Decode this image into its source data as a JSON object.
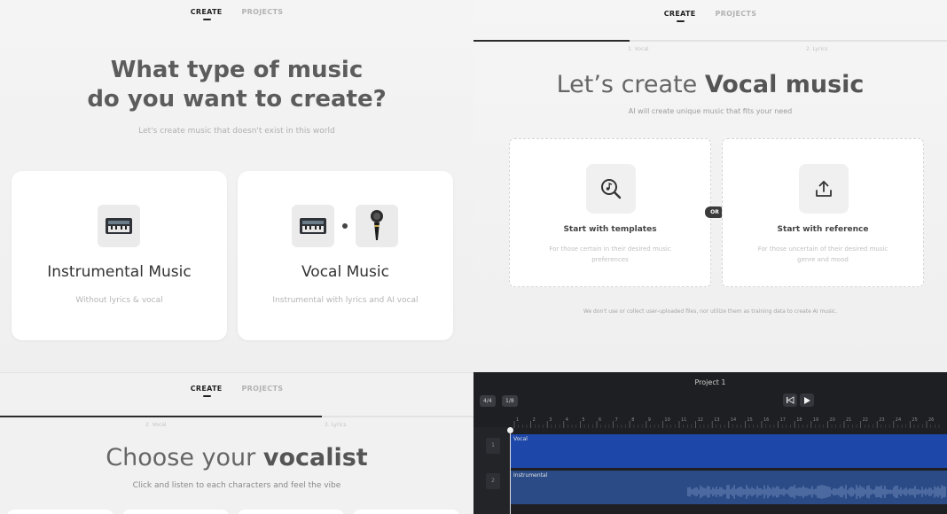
{
  "nav": {
    "create": "CREATE",
    "projects": "PROJECTS"
  },
  "screen1": {
    "title_line1": "What type of music",
    "title_line2": "do you want to create?",
    "subtitle": "Let's create music that doesn't exist in this world",
    "cards": [
      {
        "title": "Instrumental Music",
        "desc": "Without lyrics & vocal",
        "icons": [
          "keyboard-icon"
        ]
      },
      {
        "title": "Vocal Music",
        "desc": "Instrumental with lyrics and AI vocal",
        "icons": [
          "keyboard-icon",
          "microphone-icon"
        ]
      }
    ]
  },
  "screen2": {
    "progress_fraction": 0.33,
    "step1": "1. Vocal",
    "step2": "2. Lyrics",
    "title_prefix": "Let’s create ",
    "title_bold": "Vocal music",
    "subtitle": "AI will create unique music that fits your need",
    "options": [
      {
        "title": "Start with templates",
        "desc": "For those certain in their desired music preferences",
        "icon": "music-search-icon"
      },
      {
        "title": "Start with reference",
        "desc": "For those uncertain of their desired music genre and mood",
        "icon": "upload-icon"
      }
    ],
    "or_label": "OR",
    "note": "We don't use or collect user-uploaded files, nor utilize them as training data to create AI music."
  },
  "screen3": {
    "progress_fraction": 0.68,
    "step1": "2. Vocal",
    "step2": "3. Lyrics",
    "title_prefix": "Choose your ",
    "title_bold": "vocalist",
    "subtitle": "Click and listen to each characters and feel the vibe"
  },
  "editor": {
    "project_title": "Project 1",
    "time_sig": "4/4",
    "grid": "1/8",
    "ruler_ticks": [
      "1",
      "2",
      "3",
      "4",
      "5",
      "6",
      "7",
      "8",
      "9",
      "10",
      "11",
      "12",
      "13",
      "14",
      "15",
      "16",
      "17",
      "18",
      "19",
      "20",
      "21",
      "22",
      "23",
      "24",
      "25",
      "26"
    ],
    "tracks": [
      {
        "number": "1",
        "name": "Vocal",
        "color": "#1d47a8"
      },
      {
        "number": "2",
        "name": "Instrumental",
        "color": "#2a4b86"
      }
    ]
  }
}
